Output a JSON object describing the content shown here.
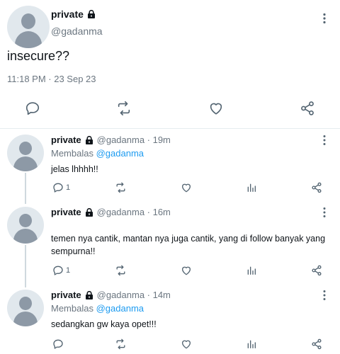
{
  "main_tweet": {
    "author_name": "private",
    "handle": "@gadanma",
    "text": "insecure??",
    "timestamp": "11:18 PM · 23 Sep 23"
  },
  "replies": [
    {
      "author_name": "private",
      "handle_time": "@gadanma · 19m",
      "replying_prefix": "Membalas",
      "replying_to": "@gadanma",
      "text": "jelas lhhhh!!",
      "reply_count": "1"
    },
    {
      "author_name": "private",
      "handle_time": "@gadanma · 16m",
      "replying_prefix": "",
      "replying_to": "",
      "text": "temen nya cantik, mantan nya juga cantik, yang di follow banyak yang sempurna!!",
      "reply_count": "1"
    },
    {
      "author_name": "private",
      "handle_time": "@gadanma · 14m",
      "replying_prefix": "Membalas",
      "replying_to": "@gadanma",
      "text": "sedangkan gw kaya opet!!!",
      "reply_count": ""
    }
  ],
  "colors": {
    "accent": "#1d9bf0",
    "icon": "#536471",
    "text": "#0f1419",
    "muted": "#6b7680"
  },
  "icons": [
    "lock-icon",
    "more-icon",
    "reply-icon",
    "retweet-icon",
    "like-icon",
    "views-icon",
    "share-icon"
  ]
}
